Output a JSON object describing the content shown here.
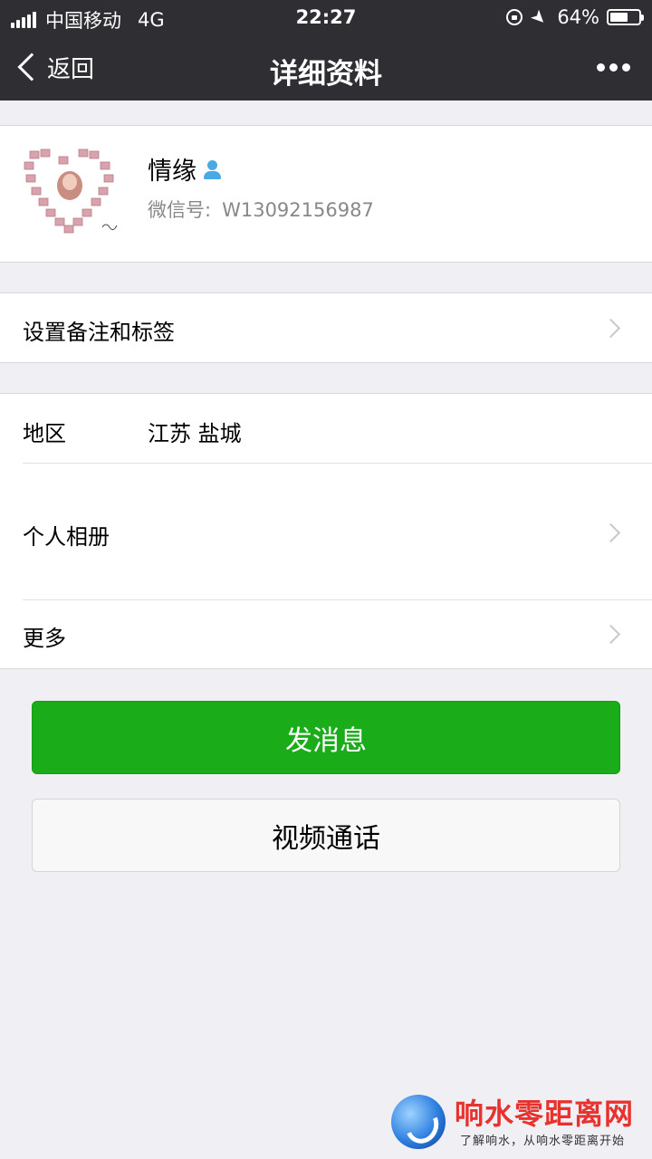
{
  "status_bar": {
    "carrier": "中国移动",
    "network": "4G",
    "time": "22:27",
    "battery": "64%",
    "battery_level": 0.64
  },
  "nav": {
    "back_label": "返回",
    "title": "详细资料",
    "more_icon": "ellipsis-icon"
  },
  "profile": {
    "name": "情缘",
    "wechat_id_label": "微信号:",
    "wechat_id": "W13092156987",
    "gender_icon": "male-user-icon"
  },
  "rows": {
    "remark_label": "设置备注和标签",
    "region_label": "地区",
    "region_value": "江苏 盐城",
    "album_label": "个人相册",
    "more_label": "更多"
  },
  "buttons": {
    "message": "发消息",
    "video_call": "视频通话"
  },
  "watermark": {
    "title": "响水零距离网",
    "subtitle": "了解响水，从响水零距离开始"
  },
  "colors": {
    "nav_bg": "#2e2e33",
    "primary_green": "#1aad19",
    "page_bg": "#efeff4"
  }
}
